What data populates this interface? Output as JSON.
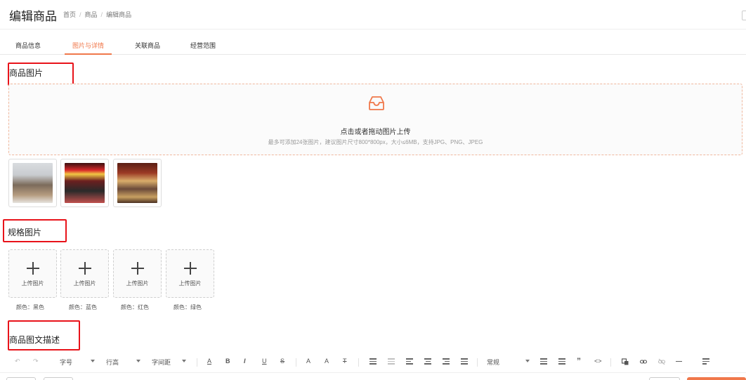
{
  "header": {
    "title": "编辑商品",
    "breadcrumb": [
      "首页",
      "商品",
      "编辑商品"
    ],
    "separator": "/"
  },
  "tabs": [
    {
      "label": "商品信息",
      "active": false
    },
    {
      "label": "图片与详情",
      "active": true
    },
    {
      "label": "关联商品",
      "active": false
    },
    {
      "label": "经营范围",
      "active": false
    }
  ],
  "accent_color": "#f0784b",
  "annotation_color": "#e8131a",
  "product_images": {
    "title": "商品图片",
    "dropzone": {
      "icon": "inbox-icon",
      "main_text": "点击或者拖动图片上传",
      "hint": "最多可添加24张图片，建议图片尺寸800*800px，大小≤6MB，支持JPG、PNG、JPEG"
    },
    "thumbnails": [
      "product-image-1",
      "product-image-2",
      "product-image-3"
    ]
  },
  "spec_images": {
    "title": "规格图片",
    "upload_label": "上传图片",
    "items": [
      {
        "color_label": "颜色：黑色"
      },
      {
        "color_label": "颜色：蓝色"
      },
      {
        "color_label": "颜色：红色"
      },
      {
        "color_label": "颜色：绿色"
      }
    ]
  },
  "description": {
    "title": "商品图文描述",
    "toolbar": {
      "undo": "↶",
      "redo": "↷",
      "font_size": "字号",
      "line_height": "行高",
      "letter_spacing": "字间距",
      "font_color": "A",
      "bold": "B",
      "italic": "I",
      "underline": "U",
      "strikethrough": "S",
      "superscript": "A",
      "subscript": "A",
      "clear_format": "T",
      "paragraph_style": "常规",
      "quote": "”",
      "code": "<>",
      "hr": "—"
    }
  }
}
